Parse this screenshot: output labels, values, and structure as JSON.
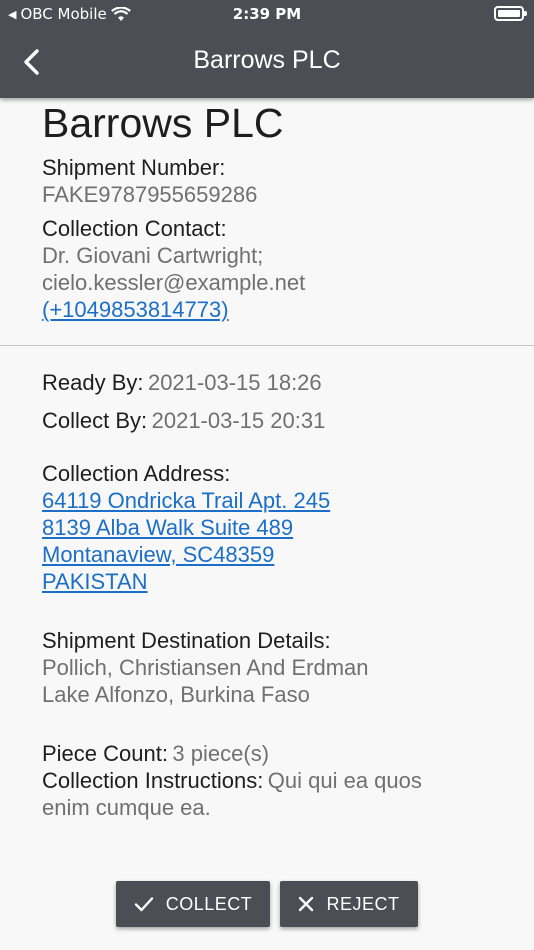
{
  "status_bar": {
    "carrier": "OBC Mobile",
    "time": "2:39 PM"
  },
  "app_bar": {
    "title": "Barrows PLC",
    "back_icon": "chevron-left-icon"
  },
  "shipment": {
    "company_name": "Barrows PLC",
    "shipment_number_label": "Shipment Number:",
    "shipment_number": "FAKE9787955659286",
    "collection_contact_label": "Collection Contact:",
    "contact_name": "Dr. Giovani Cartwright;",
    "contact_email": "cielo.kessler@example.net",
    "contact_phone": "(+1049853814773)",
    "ready_by_label": "Ready By:",
    "ready_by": "2021-03-15 18:26",
    "collect_by_label": "Collect By:",
    "collect_by": "2021-03-15 20:31",
    "collection_address_label": "Collection Address:",
    "address_lines": [
      "64119 Ondricka Trail Apt. 245",
      "8139 Alba Walk Suite 489",
      "Montanaview, SC48359",
      "PAKISTAN"
    ],
    "destination_label": "Shipment Destination Details:",
    "destination_lines": [
      "Pollich, Christiansen And Erdman",
      "Lake Alfonzo, Burkina Faso"
    ],
    "piece_count_label": "Piece Count:",
    "piece_count": "3 piece(s)",
    "instructions_label": "Collection Instructions:",
    "instructions_part1": "Qui qui ea quos",
    "instructions_part2": "enim cumque ea."
  },
  "actions": {
    "collect_label": "COLLECT",
    "reject_label": "REJECT"
  },
  "colors": {
    "app_bar": "#4b4e54",
    "background": "#f8f8f8",
    "link": "#1c6fc9",
    "value_text": "#707070"
  }
}
